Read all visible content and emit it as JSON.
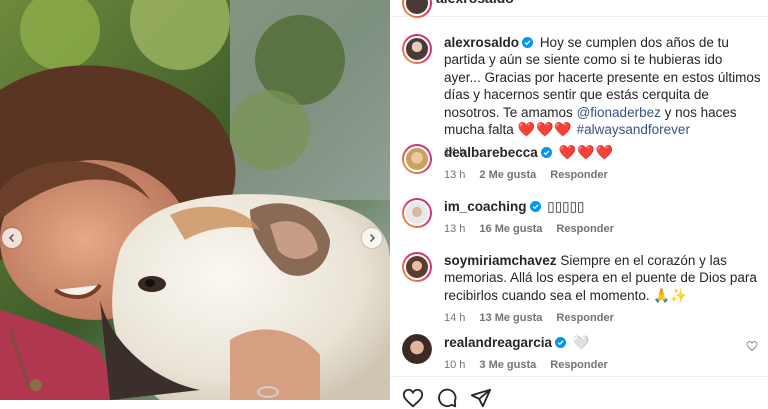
{
  "post": {
    "author": "alexrosaldo",
    "caption_text": "Hoy se cumplen dos años de tu partida y aún se siente como si te hubieras ido ayer... Gracias por hacerte presente en estos últimos días y hacernos sentir que estás cerquita de nosotros. Te amamos",
    "caption_mention": "@fionaderbez",
    "caption_after": "y nos haces mucha falta",
    "caption_emoji": "❤️❤️❤️",
    "caption_hashtag": "#alwaysandforever",
    "caption_time": "14 h"
  },
  "comments": [
    {
      "user": "dealbarebecca",
      "text": "❤️❤️❤️",
      "time": "13 h",
      "likes": "2 Me gusta",
      "reply": "Responder"
    },
    {
      "user": "im_coaching",
      "text": "▯▯▯▯▯",
      "time": "13 h",
      "likes": "16 Me gusta",
      "reply": "Responder"
    },
    {
      "user": "soymiriamchavez",
      "text": "Siempre en el corazón y las memorias. Allá los espera en el puente de Dios para recibirlos cuando sea el momento. 🙏✨",
      "time": "14 h",
      "likes": "13 Me gusta",
      "reply": "Responder"
    },
    {
      "user": "realandreagarcia",
      "text": "🤍",
      "time": "10 h",
      "likes": "3 Me gusta",
      "reply": "Responder"
    }
  ],
  "icons": {
    "like": "heart-icon",
    "comment": "comment-icon",
    "share": "share-icon",
    "verified": "verified-badge-icon",
    "carousel_prev": "chevron-left-icon",
    "carousel_next": "chevron-right-icon"
  },
  "colors": {
    "verified": "#0095f6",
    "link": "#385185",
    "heart": "#e0131b"
  }
}
